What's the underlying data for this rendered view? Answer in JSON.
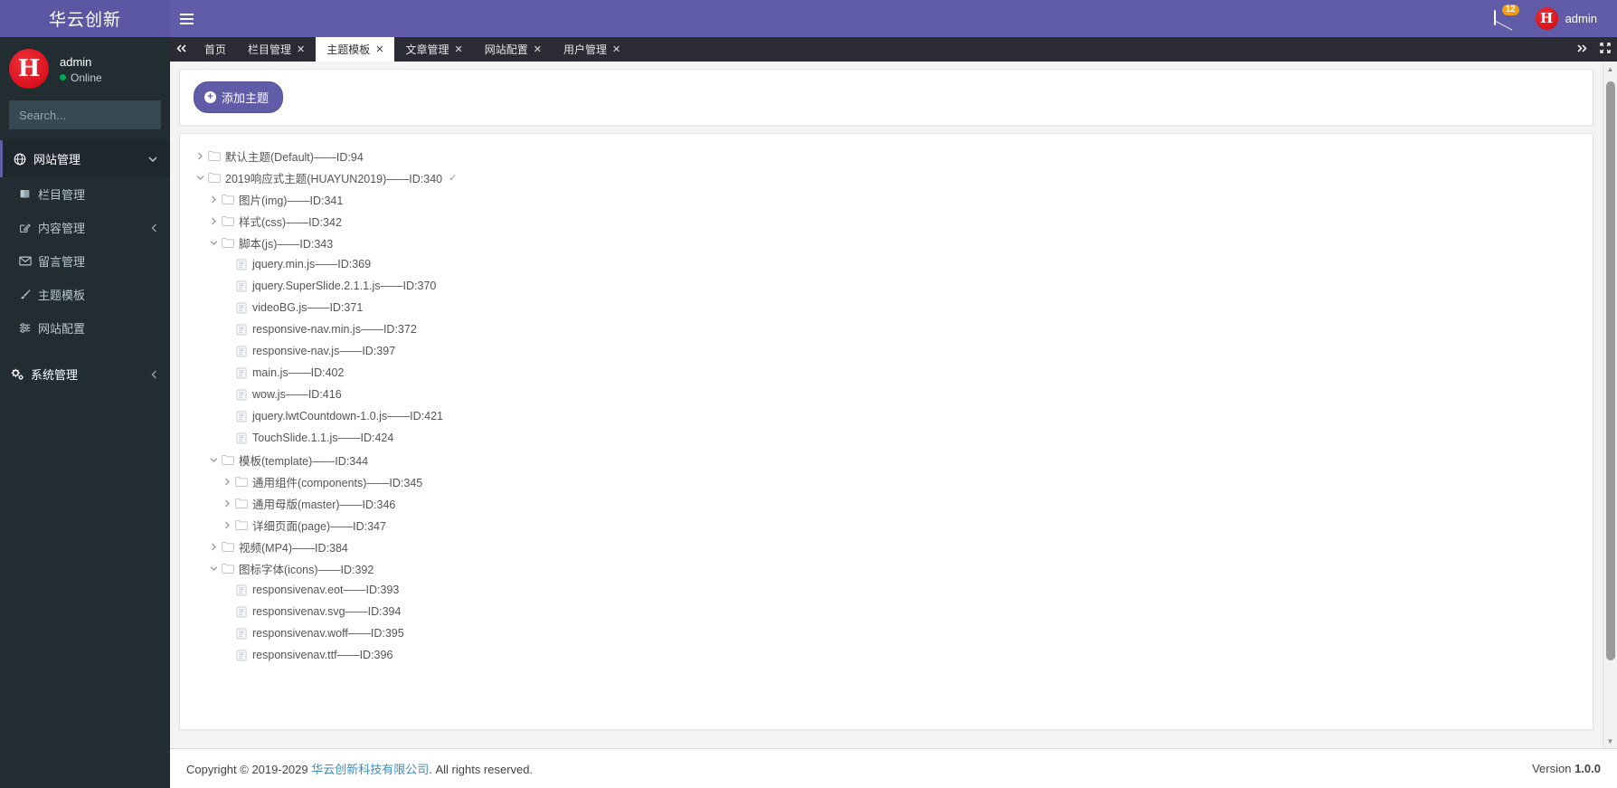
{
  "brand": {
    "title": "华云创新"
  },
  "topbar": {
    "menu_toggle_icon": "hamburger-icon",
    "messages_icon": "envelope-icon",
    "messages_badge": "12",
    "user_name": "admin",
    "avatar_letter": "H"
  },
  "sidebar": {
    "user": {
      "name": "admin",
      "status": "Online"
    },
    "search": {
      "placeholder": "Search...",
      "value": ""
    },
    "sections": [
      {
        "label": "网站管理",
        "icon": "globe-icon",
        "caret": "chevron-down-icon",
        "items": [
          {
            "label": "栏目管理",
            "icon": "book-icon",
            "caret": ""
          },
          {
            "label": "内容管理",
            "icon": "edit-icon",
            "caret": "chevron-left-icon"
          },
          {
            "label": "留言管理",
            "icon": "envelope-icon",
            "caret": ""
          },
          {
            "label": "主题模板",
            "icon": "brush-icon",
            "caret": ""
          },
          {
            "label": "网站配置",
            "icon": "sliders-icon",
            "caret": ""
          }
        ]
      },
      {
        "label": "系统管理",
        "icon": "gears-icon",
        "caret": "chevron-left-icon",
        "items": []
      }
    ]
  },
  "tabbar": {
    "prev_icon": "double-chevron-left-icon",
    "next_icon": "double-chevron-right-icon",
    "fullscreen_icon": "fullscreen-icon",
    "close_label": "✕",
    "tabs": [
      {
        "label": "首页",
        "closable": false,
        "active": false
      },
      {
        "label": "栏目管理",
        "closable": true,
        "active": false
      },
      {
        "label": "主题模板",
        "closable": true,
        "active": true
      },
      {
        "label": "文章管理",
        "closable": true,
        "active": false
      },
      {
        "label": "网站配置",
        "closable": true,
        "active": false
      },
      {
        "label": "用户管理",
        "closable": true,
        "active": false
      }
    ]
  },
  "toolbar": {
    "add_theme_label": "添加主题",
    "add_icon": "plus-circle-icon"
  },
  "tree": {
    "nodes": [
      {
        "depth": 0,
        "twist": "right",
        "icon": "folder-icon",
        "label": "默认主题(Default)——ID:94",
        "check": ""
      },
      {
        "depth": 0,
        "twist": "down",
        "icon": "folder-icon",
        "label": "2019响应式主题(HUAYUN2019)——ID:340",
        "check": "✓"
      },
      {
        "depth": 1,
        "twist": "right",
        "icon": "folder-icon",
        "label": "图片(img)——ID:341",
        "check": ""
      },
      {
        "depth": 1,
        "twist": "right",
        "icon": "folder-icon",
        "label": "样式(css)——ID:342",
        "check": ""
      },
      {
        "depth": 1,
        "twist": "down",
        "icon": "folder-icon",
        "label": "脚本(js)——ID:343",
        "check": ""
      },
      {
        "depth": 2,
        "twist": "none",
        "icon": "file-icon",
        "label": "jquery.min.js——ID:369",
        "check": ""
      },
      {
        "depth": 2,
        "twist": "none",
        "icon": "file-icon",
        "label": "jquery.SuperSlide.2.1.1.js——ID:370",
        "check": ""
      },
      {
        "depth": 2,
        "twist": "none",
        "icon": "file-icon",
        "label": "videoBG.js——ID:371",
        "check": ""
      },
      {
        "depth": 2,
        "twist": "none",
        "icon": "file-icon",
        "label": "responsive-nav.min.js——ID:372",
        "check": ""
      },
      {
        "depth": 2,
        "twist": "none",
        "icon": "file-icon",
        "label": "responsive-nav.js——ID:397",
        "check": ""
      },
      {
        "depth": 2,
        "twist": "none",
        "icon": "file-icon",
        "label": "main.js——ID:402",
        "check": ""
      },
      {
        "depth": 2,
        "twist": "none",
        "icon": "file-icon",
        "label": "wow.js——ID:416",
        "check": ""
      },
      {
        "depth": 2,
        "twist": "none",
        "icon": "file-icon",
        "label": "jquery.lwtCountdown-1.0.js——ID:421",
        "check": ""
      },
      {
        "depth": 2,
        "twist": "none",
        "icon": "file-icon",
        "label": "TouchSlide.1.1.js——ID:424",
        "check": ""
      },
      {
        "depth": 1,
        "twist": "down",
        "icon": "folder-icon",
        "label": "模板(template)——ID:344",
        "check": ""
      },
      {
        "depth": 2,
        "twist": "right",
        "icon": "folder-icon",
        "label": "通用组件(components)——ID:345",
        "check": ""
      },
      {
        "depth": 2,
        "twist": "right",
        "icon": "folder-icon",
        "label": "通用母版(master)——ID:346",
        "check": ""
      },
      {
        "depth": 2,
        "twist": "right",
        "icon": "folder-icon",
        "label": "详细页面(page)——ID:347",
        "check": ""
      },
      {
        "depth": 1,
        "twist": "right",
        "icon": "folder-icon",
        "label": "视频(MP4)——ID:384",
        "check": ""
      },
      {
        "depth": 1,
        "twist": "down",
        "icon": "folder-icon",
        "label": "图标字体(icons)——ID:392",
        "check": ""
      },
      {
        "depth": 2,
        "twist": "none",
        "icon": "file-icon",
        "label": "responsivenav.eot——ID:393",
        "check": ""
      },
      {
        "depth": 2,
        "twist": "none",
        "icon": "file-icon",
        "label": "responsivenav.svg——ID:394",
        "check": ""
      },
      {
        "depth": 2,
        "twist": "none",
        "icon": "file-icon",
        "label": "responsivenav.woff——ID:395",
        "check": ""
      },
      {
        "depth": 2,
        "twist": "none",
        "icon": "file-icon",
        "label": "responsivenav.ttf——ID:396",
        "check": ""
      }
    ]
  },
  "footer": {
    "copyright_prefix": "Copyright © 2019-2029 ",
    "company": "华云创新科技有限公司",
    "copyright_suffix": ". All rights reserved.",
    "version_label": "Version ",
    "version_number": "1.0.0"
  },
  "colors": {
    "brand_purple": "#605ca8",
    "sidebar_dark": "#222d32",
    "badge_orange": "#f39c12",
    "link_blue": "#3c8dbc",
    "online_green": "#00a65a"
  }
}
